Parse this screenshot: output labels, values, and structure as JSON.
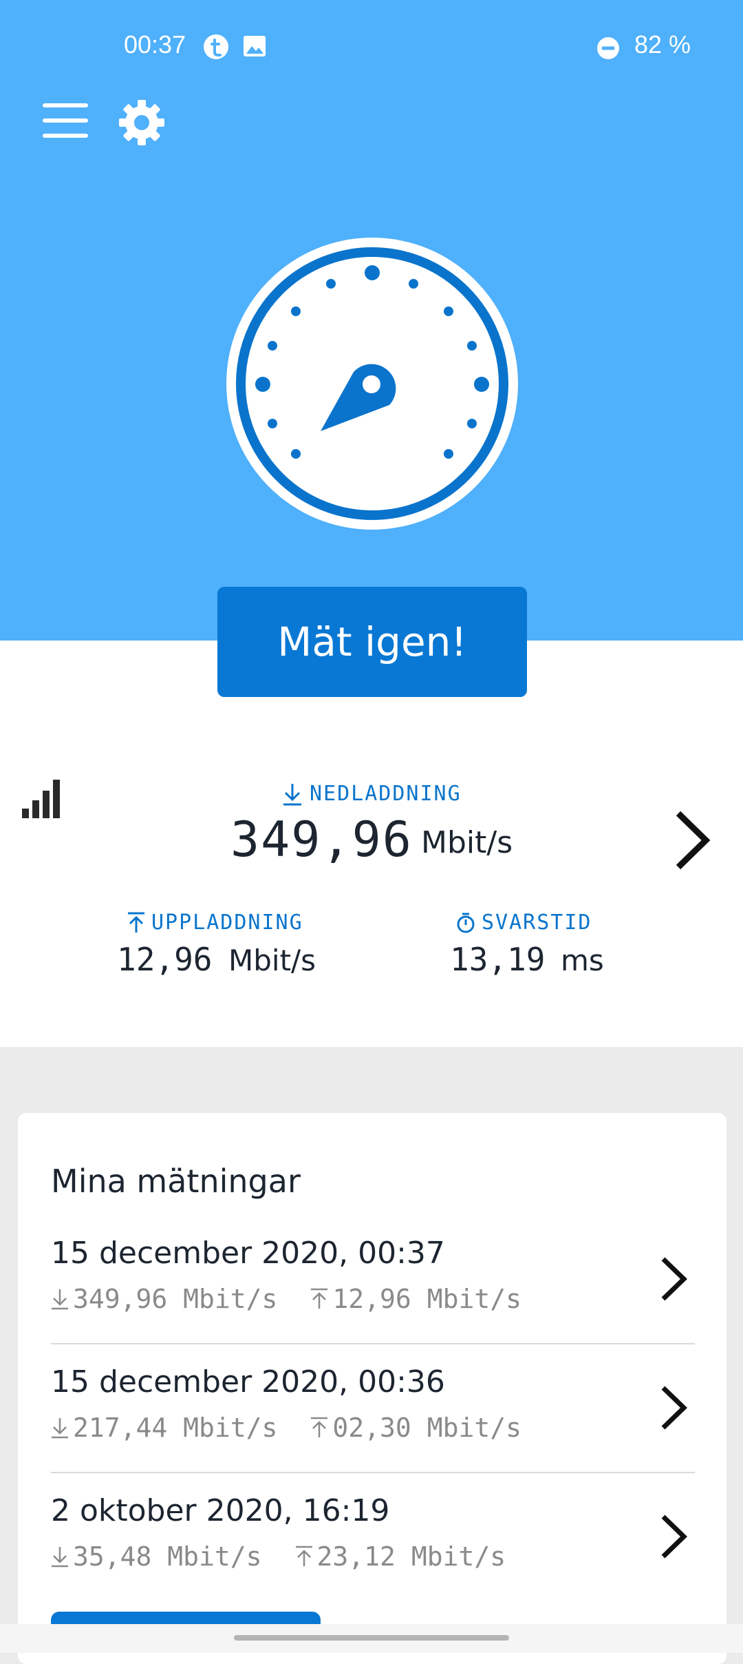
{
  "status_bar": {
    "time": "00:37",
    "battery": "82 %",
    "icons": [
      "tumblr-notification-icon",
      "image-notification-icon",
      "do-not-disturb-icon"
    ]
  },
  "toolbar": {
    "icons": [
      "hamburger-menu-icon",
      "gear-icon"
    ]
  },
  "gauge": {
    "icon": "speedometer-gauge-icon"
  },
  "main_button": {
    "label": "Mät igen!"
  },
  "results": {
    "download": {
      "label": "NEDLADDNING",
      "value": "349,96",
      "unit": "Mbit/s"
    },
    "upload": {
      "label": "UPPLADDNING",
      "value": "12,96",
      "unit": "Mbit/s"
    },
    "latency": {
      "label": "SVARSTID",
      "value": "13,19",
      "unit": "ms"
    }
  },
  "history": {
    "title": "Mina mätningar",
    "items": [
      {
        "date": "15 december 2020, 00:37",
        "download": "349,96 Mbit/s",
        "upload": "12,96 Mbit/s"
      },
      {
        "date": "15 december 2020, 00:36",
        "download": "217,44 Mbit/s",
        "upload": "02,30 Mbit/s"
      },
      {
        "date": "2 oktober 2020, 16:19",
        "download": "35,48 Mbit/s",
        "upload": "23,12 Mbit/s"
      }
    ]
  },
  "colors": {
    "hero_background": "#4fb0fb",
    "accent": "#0978d4",
    "label_blue": "#0a74cc",
    "text_dark": "#1c2530",
    "text_gray": "#8a8a8a"
  }
}
